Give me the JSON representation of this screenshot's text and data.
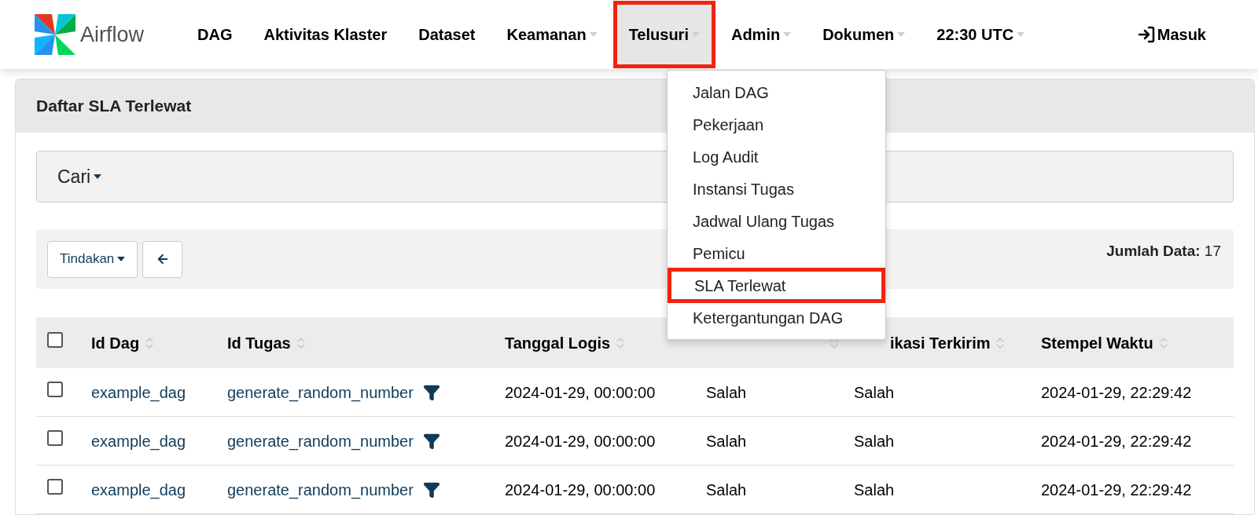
{
  "brand": {
    "name": "Airflow"
  },
  "nav": [
    {
      "label": "DAG",
      "has_caret": false,
      "highlighted": false
    },
    {
      "label": "Aktivitas Klaster",
      "has_caret": false,
      "highlighted": false
    },
    {
      "label": "Dataset",
      "has_caret": false,
      "highlighted": false
    },
    {
      "label": "Keamanan",
      "has_caret": true,
      "highlighted": false
    },
    {
      "label": "Telusuri",
      "has_caret": true,
      "highlighted": true
    },
    {
      "label": "Admin",
      "has_caret": true,
      "highlighted": false
    },
    {
      "label": "Dokumen",
      "has_caret": true,
      "highlighted": false
    },
    {
      "label": "22:30 UTC",
      "has_caret": true,
      "highlighted": false
    }
  ],
  "login": {
    "label": "Masuk"
  },
  "menu": [
    {
      "label": "Jalan DAG",
      "highlighted": false
    },
    {
      "label": "Pekerjaan",
      "highlighted": false
    },
    {
      "label": "Log Audit",
      "highlighted": false
    },
    {
      "label": "Instansi Tugas",
      "highlighted": false
    },
    {
      "label": "Jadwal Ulang Tugas",
      "highlighted": false
    },
    {
      "label": "Pemicu",
      "highlighted": false
    },
    {
      "label": "SLA Terlewat",
      "highlighted": true
    },
    {
      "label": "Ketergantungan DAG",
      "highlighted": false
    }
  ],
  "panel": {
    "title": "Daftar SLA Terlewat"
  },
  "search": {
    "label": "Cari"
  },
  "actions": {
    "label": "Tindakan"
  },
  "record_count": {
    "label": "Jumlah Data:",
    "value": "17"
  },
  "table": {
    "all_checked": false,
    "columns": [
      {
        "label": "Id Dag"
      },
      {
        "label": "Id Tugas"
      },
      {
        "label": "Tanggal Logis"
      },
      {},
      {
        "label": "ikasi Terkirim"
      },
      {
        "label": "Stempel Waktu"
      }
    ],
    "rows": [
      {
        "checked": false,
        "cells": [
          "example_dag",
          "generate_random_number",
          "2024-01-29, 00:00:00",
          "Salah",
          "Salah",
          "2024-01-29, 22:29:42"
        ]
      },
      {
        "checked": false,
        "cells": [
          "example_dag",
          "generate_random_number",
          "2024-01-29, 00:00:00",
          "Salah",
          "Salah",
          "2024-01-29, 22:29:42"
        ]
      },
      {
        "checked": false,
        "cells": [
          "example_dag",
          "generate_random_number",
          "2024-01-29, 00:00:00",
          "Salah",
          "Salah",
          "2024-01-29, 22:29:42"
        ]
      }
    ]
  }
}
